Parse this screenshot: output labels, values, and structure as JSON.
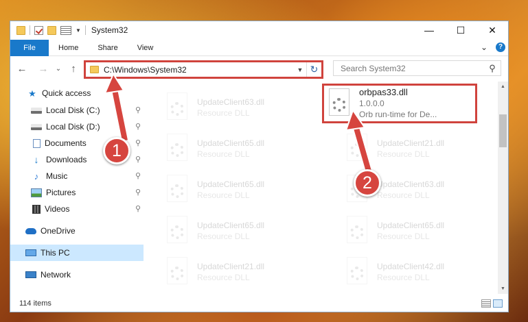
{
  "window": {
    "title": "System32",
    "controls": {
      "minimize": "—",
      "maximize": "☐",
      "close": "✕"
    }
  },
  "ribbon": {
    "tabs": [
      {
        "label": "File"
      },
      {
        "label": "Home"
      },
      {
        "label": "Share"
      },
      {
        "label": "View"
      }
    ],
    "expand_glyph": "⌄",
    "help_glyph": "?"
  },
  "navigation": {
    "back": "←",
    "forward": "→",
    "recent": "⌄",
    "up": "↑",
    "address": "C:\\Windows\\System32",
    "refresh": "↻",
    "search_placeholder": "Search System32"
  },
  "sidebar": {
    "items": [
      {
        "label": "Quick access",
        "icon": "star-icon",
        "pinned": false
      },
      {
        "label": "Local Disk (C:)",
        "icon": "disk-icon",
        "pinned": true
      },
      {
        "label": "Local Disk (D:)",
        "icon": "disk-icon",
        "pinned": true
      },
      {
        "label": "Documents",
        "icon": "documents-icon",
        "pinned": true
      },
      {
        "label": "Downloads",
        "icon": "download-icon",
        "pinned": true
      },
      {
        "label": "Music",
        "icon": "music-icon",
        "pinned": true
      },
      {
        "label": "Pictures",
        "icon": "pictures-icon",
        "pinned": true
      },
      {
        "label": "Videos",
        "icon": "videos-icon",
        "pinned": true
      },
      {
        "label": "OneDrive",
        "icon": "cloud-icon",
        "pinned": false
      },
      {
        "label": "This PC",
        "icon": "computer-icon",
        "pinned": false,
        "selected": true
      },
      {
        "label": "Network",
        "icon": "network-icon",
        "pinned": false
      }
    ],
    "pin_glyph": "📌"
  },
  "files": {
    "column_left": [
      {
        "name": "UpdateClient63.dll",
        "type": "Resource DLL"
      },
      {
        "name": "UpdateClient65.dll",
        "type": "Resource DLL"
      },
      {
        "name": "UpdateClient65.dll",
        "type": "Resource DLL"
      },
      {
        "name": "UpdateClient65.dll",
        "type": "Resource DLL"
      },
      {
        "name": "UpdateClient21.dll",
        "type": "Resource DLL"
      }
    ],
    "column_right": [
      {
        "name": "orbpas33.dll",
        "version": "1.0.0.0",
        "description": "Orb run-time for De...",
        "highlighted": true
      },
      {
        "name": "UpdateClient21.dll",
        "type": "Resource DLL"
      },
      {
        "name": "UpdateClient63.dll",
        "type": "Resource DLL"
      },
      {
        "name": "UpdateClient65.dll",
        "type": "Resource DLL"
      },
      {
        "name": "UpdateClient42.dll",
        "type": "Resource DLL"
      }
    ]
  },
  "status": {
    "item_count": "114 items"
  },
  "annotations": {
    "callout_1": "1",
    "callout_2": "2",
    "accent_color": "#d6453f"
  }
}
